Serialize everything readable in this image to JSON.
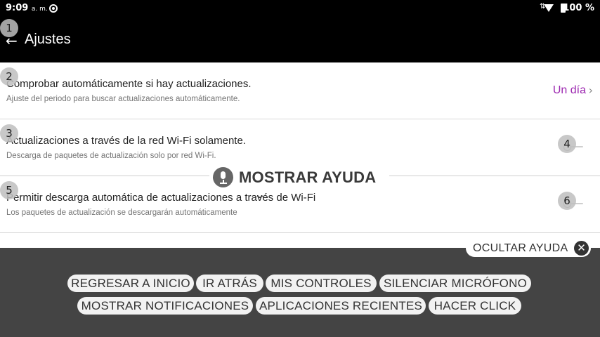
{
  "status_bar": {
    "time": "9:09",
    "ampm": "a. m.",
    "battery": "100 %"
  },
  "app_bar": {
    "title": "Ajustes",
    "back_icon": "arrow-left-icon"
  },
  "settings": [
    {
      "title": "Comprobar automáticamente si hay actualizaciones.",
      "subtitle": "Ajuste del periodo para buscar actualizaciones automáticamente.",
      "value": "Un día"
    },
    {
      "title": "Actualizaciones a través de la red Wi-Fi solamente.",
      "subtitle": "Descarga de paquetes de actualización solo por red Wi-Fi.",
      "toggle": false
    },
    {
      "title": "Permitir descarga automática de actualizaciones a través de Wi-Fi",
      "subtitle": "Los paquetes de actualización se descargarán automáticamente",
      "toggle": false
    }
  ],
  "badges": [
    "1",
    "2",
    "3",
    "4",
    "5",
    "6"
  ],
  "voice_help": {
    "label": "MOSTRAR AYUDA",
    "hide_label": "OCULTAR AYUDA"
  },
  "commands": [
    "REGRESAR A INICIO",
    "IR ATRÁS",
    "MIS CONTROLES",
    "SILENCIAR MICRÓFONO",
    "MOSTRAR NOTIFICACIONES",
    "APLICACIONES RECIENTES",
    "HACER CLICK"
  ],
  "colors": {
    "accent": "#9c27b0",
    "bar": "#000000",
    "panel": "#444444"
  }
}
